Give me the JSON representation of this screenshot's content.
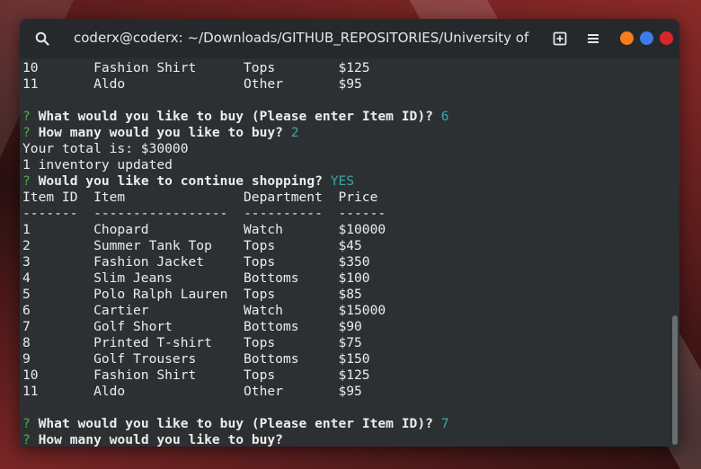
{
  "window": {
    "title": "coderx@coderx: ~/Downloads/GITHUB_REPOSITORIES/University of Texa...",
    "colors": {
      "minimize": "#f57c1f",
      "maximize": "#3d7dea",
      "close": "#d8262b"
    }
  },
  "terminal": {
    "prompt_symbol": "?",
    "colors": {
      "prompt": "#4caf50",
      "answer": "#3aa7a3",
      "text": "#ececec",
      "background": "#2d3032"
    },
    "lines": [
      {
        "kind": "plain",
        "text": "10       Fashion Shirt      Tops        $125"
      },
      {
        "kind": "plain",
        "text": "11       Aldo               Other       $95"
      },
      {
        "kind": "blank",
        "text": ""
      },
      {
        "kind": "question",
        "text": "What would you like to buy (Please enter Item ID)?",
        "answer": "6"
      },
      {
        "kind": "question",
        "text": "How many would you like to buy?",
        "answer": "2"
      },
      {
        "kind": "plain",
        "text": "Your total is: $30000"
      },
      {
        "kind": "plain",
        "text": "1 inventory updated"
      },
      {
        "kind": "question",
        "text": "Would you like to continue shopping?",
        "answer": "YES"
      },
      {
        "kind": "plain",
        "text": "Item ID  Item               Department  Price"
      },
      {
        "kind": "plain",
        "text": "-------  -----------------  ----------  ------"
      },
      {
        "kind": "plain",
        "text": "1        Chopard            Watch       $10000"
      },
      {
        "kind": "plain",
        "text": "2        Summer Tank Top    Tops        $45"
      },
      {
        "kind": "plain",
        "text": "3        Fashion Jacket     Tops        $350"
      },
      {
        "kind": "plain",
        "text": "4        Slim Jeans         Bottoms     $100"
      },
      {
        "kind": "plain",
        "text": "5        Polo Ralph Lauren  Tops        $85"
      },
      {
        "kind": "plain",
        "text": "6        Cartier            Watch       $15000"
      },
      {
        "kind": "plain",
        "text": "7        Golf Short         Bottoms     $90"
      },
      {
        "kind": "plain",
        "text": "8        Printed T-shirt    Tops        $75"
      },
      {
        "kind": "plain",
        "text": "9        Golf Trousers      Bottoms     $150"
      },
      {
        "kind": "plain",
        "text": "10       Fashion Shirt      Tops        $125"
      },
      {
        "kind": "plain",
        "text": "11       Aldo               Other       $95"
      },
      {
        "kind": "blank",
        "text": ""
      },
      {
        "kind": "question",
        "text": "What would you like to buy (Please enter Item ID)?",
        "answer": "7"
      },
      {
        "kind": "question",
        "text": "How many would you like to buy?",
        "answer": ""
      }
    ]
  }
}
